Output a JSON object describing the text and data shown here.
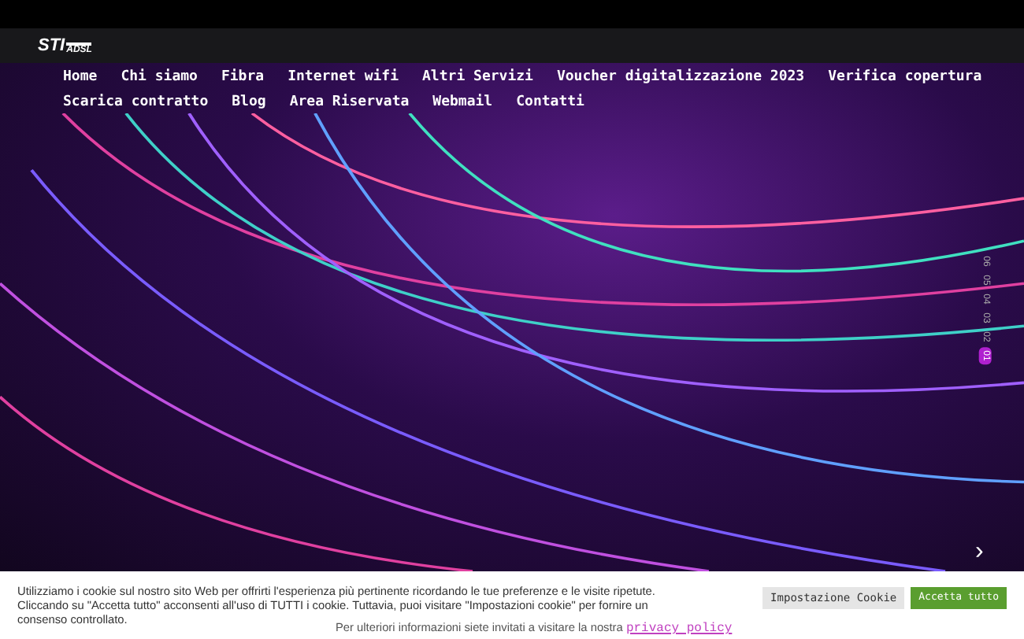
{
  "header": {
    "logo": {
      "main": "STI",
      "sub": "ADSL"
    }
  },
  "nav": {
    "items": [
      {
        "label": "Home"
      },
      {
        "label": "Chi siamo"
      },
      {
        "label": "Fibra"
      },
      {
        "label": "Internet wifi"
      },
      {
        "label": "Altri Servizi"
      },
      {
        "label": "Voucher digitalizzazione 2023"
      },
      {
        "label": "Verifica copertura"
      },
      {
        "label": "Scarica contratto"
      },
      {
        "label": "Blog"
      },
      {
        "label": "Area Riservata"
      },
      {
        "label": "Webmail"
      },
      {
        "label": "Contatti"
      }
    ]
  },
  "slider": {
    "indicators": [
      {
        "label": "06",
        "selected": false
      },
      {
        "label": "05",
        "selected": false
      },
      {
        "label": "04",
        "selected": false
      },
      {
        "label": "03",
        "selected": false
      },
      {
        "label": "02",
        "selected": false
      },
      {
        "label": "01",
        "selected": true
      }
    ],
    "next": "›"
  },
  "cookie_banner": {
    "text": "Utilizziamo i cookie sul nostro sito Web per offrirti l'esperienza più pertinente ricordando le tue preferenze e le visite ripetute. Cliccando su \"Accetta tutto\" acconsenti all'uso di TUTTI i cookie. Tuttavia, puoi visitare \"Impostazioni cookie\" per fornire un consenso controllato.",
    "buttons": [
      {
        "label": "Impostazione Cookie",
        "kind": "secondary"
      },
      {
        "label": "Accetta tutto",
        "kind": "primary"
      }
    ],
    "note": "Per ulteriori informazioni siete invitati a visitare la nostra",
    "link": "privacy policy"
  }
}
